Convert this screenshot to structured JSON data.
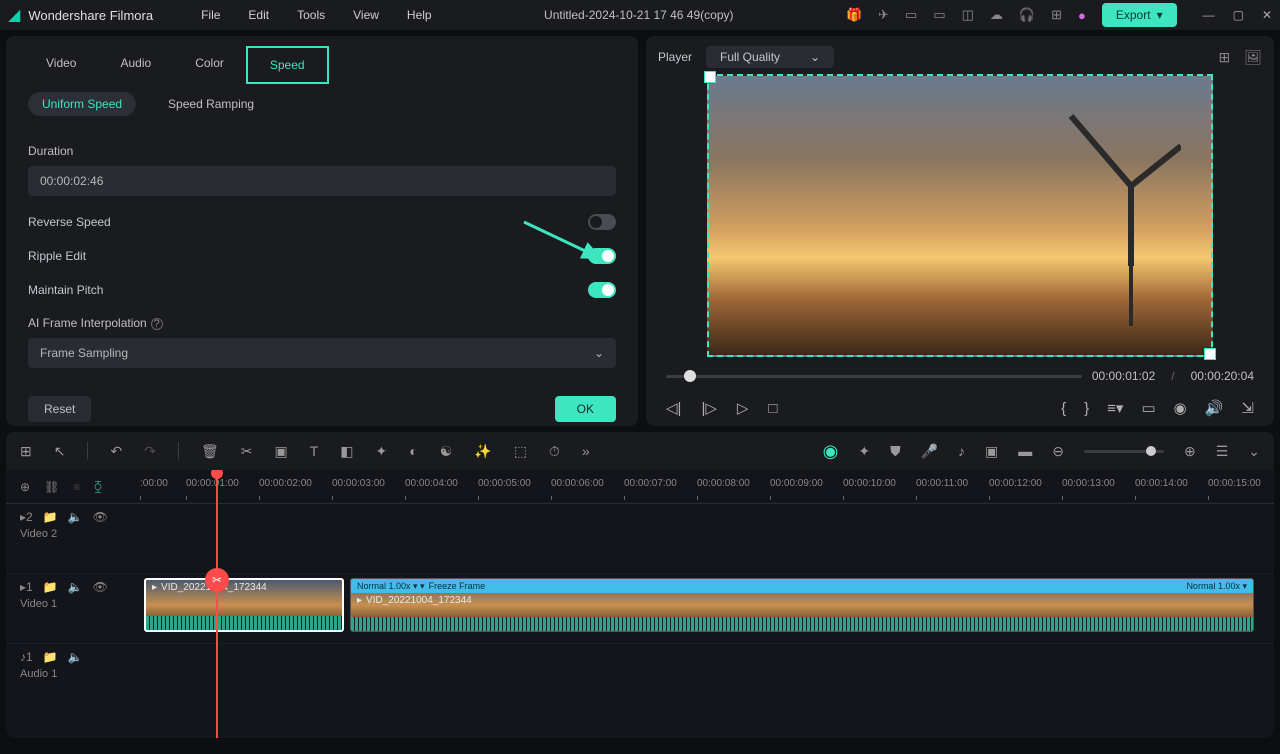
{
  "app": {
    "name": "Wondershare Filmora",
    "title": "Untitled-2024-10-21 17 46 49(copy)",
    "export_label": "Export"
  },
  "menubar": [
    "File",
    "Edit",
    "Tools",
    "View",
    "Help"
  ],
  "tabs": [
    "Video",
    "Audio",
    "Color",
    "Speed"
  ],
  "subtabs": {
    "uniform": "Uniform Speed",
    "ramping": "Speed Ramping"
  },
  "speed_panel": {
    "duration_label": "Duration",
    "duration_value": "00:00:02:46",
    "reverse_label": "Reverse Speed",
    "ripple_label": "Ripple Edit",
    "pitch_label": "Maintain Pitch",
    "ai_label": "AI Frame Interpolation",
    "ai_select": "Frame Sampling",
    "reset": "Reset",
    "ok": "OK"
  },
  "player": {
    "label": "Player",
    "quality": "Full Quality",
    "current_time": "00:00:01:02",
    "total_time": "00:00:20:04"
  },
  "timeline": {
    "ticks": [
      ":00:00",
      "00:00:01:00",
      "00:00:02:00",
      "00:00:03:00",
      "00:00:04:00",
      "00:00:05:00",
      "00:00:06:00",
      "00:00:07:00",
      "00:00:08:00",
      "00:00:09:00",
      "00:00:10:00",
      "00:00:11:00",
      "00:00:12:00",
      "00:00:13:00",
      "00:00:14:00",
      "00:00:15:00"
    ],
    "tracks": {
      "video2": {
        "icon_label": "2",
        "name": "Video 2"
      },
      "video1": {
        "icon_label": "1",
        "name": "Video 1"
      },
      "audio1": {
        "icon_label": "1",
        "name": "Audio 1"
      }
    },
    "clips": {
      "a": {
        "label": "VID_20221004_172344"
      },
      "b": {
        "speed": "Normal 1.00x",
        "freeze": "Freeze Frame",
        "speed2": "Normal 1.00x",
        "label": "VID_20221004_172344"
      }
    }
  }
}
